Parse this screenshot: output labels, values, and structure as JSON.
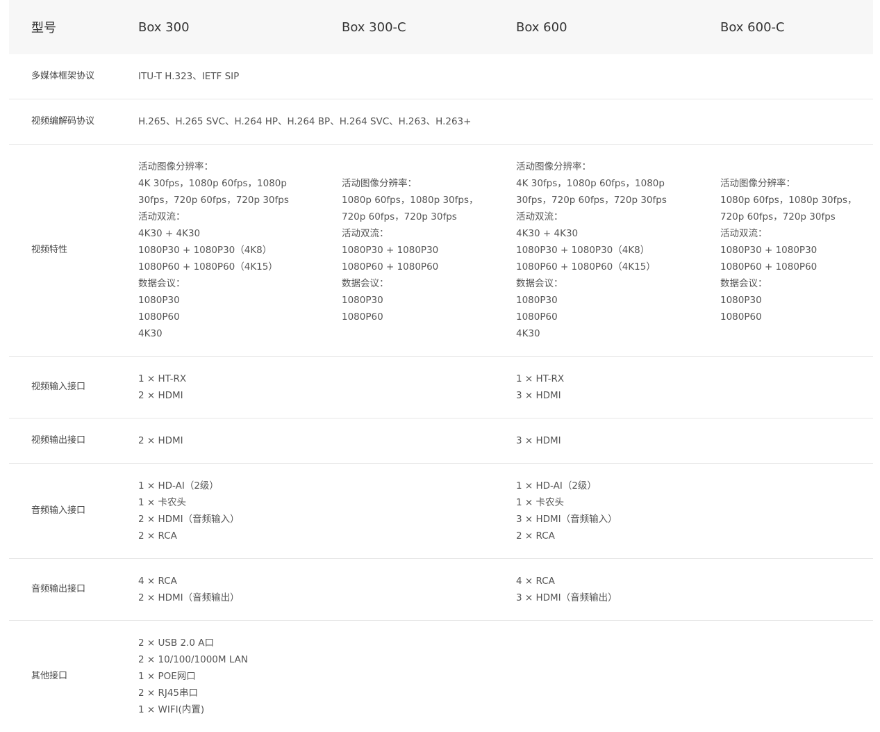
{
  "header": {
    "model_label": "型号",
    "models": [
      "Box 300",
      "Box 300-C",
      "Box 600",
      "Box 600-C"
    ]
  },
  "rows": {
    "protocol": {
      "label": "多媒体框架协议",
      "value": "ITU-T H.323、IETF SIP"
    },
    "codec": {
      "label": "视频编解码协议",
      "value": "H.265、H.265 SVC、H.264 HP、H.264 BP、H.264 SVC、H.263、H.263+"
    },
    "video_features": {
      "label": "视频特性",
      "box300": [
        "活动图像分辨率：",
        "4K 30fps，1080p 60fps，1080p",
        "30fps，720p 60fps，720p 30fps",
        "活动双流：",
        "4K30 + 4K30",
        "1080P30 + 1080P30（4K8）",
        "1080P60 + 1080P60（4K15）",
        "数据会议：",
        "1080P30",
        "1080P60",
        "4K30"
      ],
      "box300c": [
        "活动图像分辨率：",
        "1080p 60fps，1080p 30fps，",
        "720p 60fps，720p 30fps",
        "活动双流：",
        "1080P30 + 1080P30",
        "1080P60 + 1080P60",
        "数据会议：",
        "1080P30",
        "1080P60"
      ],
      "box600": [
        "活动图像分辨率：",
        "4K 30fps，1080p 60fps，1080p",
        "30fps，720p 60fps，720p 30fps",
        "活动双流：",
        "4K30 + 4K30",
        "1080P30 + 1080P30（4K8）",
        "1080P60 + 1080P60（4K15）",
        "数据会议：",
        "1080P30",
        "1080P60",
        "4K30"
      ],
      "box600c": [
        "活动图像分辨率：",
        "1080p 60fps，1080p 30fps，",
        "720p 60fps，720p 30fps",
        "活动双流：",
        "1080P30 + 1080P30",
        "1080P60 + 1080P60",
        "数据会议：",
        "1080P30",
        "1080P60"
      ]
    },
    "video_input": {
      "label": "视频输入接口",
      "box300": [
        "1 × HT-RX",
        "2 × HDMI"
      ],
      "box600": [
        "1 × HT-RX",
        "3 × HDMI"
      ]
    },
    "video_output": {
      "label": "视频输出接口",
      "box300": [
        "2 × HDMI"
      ],
      "box600": [
        "3 × HDMI"
      ]
    },
    "audio_input": {
      "label": "音频输入接口",
      "box300": [
        "1 × HD-AI（2级）",
        "1 × 卡农头",
        "2 × HDMI（音频输入）",
        "2 × RCA"
      ],
      "box600": [
        "1 × HD-AI（2级）",
        "1 × 卡农头",
        "3 × HDMI（音频输入）",
        "2 × RCA"
      ]
    },
    "audio_output": {
      "label": "音频输出接口",
      "box300": [
        "4 × RCA",
        "2 × HDMI（音频输出）"
      ],
      "box600": [
        "4 × RCA",
        "3 × HDMI（音频输出）"
      ]
    },
    "other": {
      "label": "其他接口",
      "box300": [
        "2 × USB 2.0 A口",
        "2 × 10/100/1000M LAN",
        "1 × POE网口",
        "2 × RJ45串口",
        "1 × WIFI(内置)"
      ]
    }
  }
}
